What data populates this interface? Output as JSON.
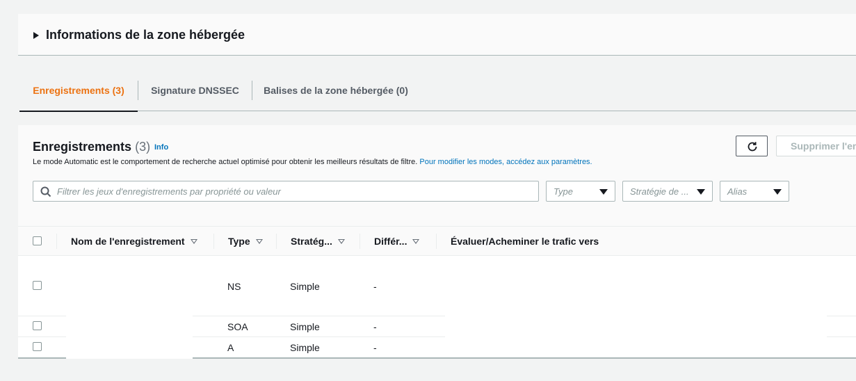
{
  "info_panel": {
    "title": "Informations de la zone hébergée"
  },
  "tabs": [
    {
      "label": "Enregistrements (3)",
      "active": true
    },
    {
      "label": "Signature DNSSEC",
      "active": false
    },
    {
      "label": "Balises de la zone hébergée (0)",
      "active": false
    }
  ],
  "records": {
    "title": "Enregistrements",
    "count": "(3)",
    "info_label": "Info",
    "description": "Le mode Automatic est le comportement de recherche actuel optimisé pour obtenir les meilleurs résultats de filtre.",
    "description_link": "Pour modifier les modes, accédez aux paramètres.",
    "delete_label": "Supprimer l'enregistrement",
    "search_placeholder": "Filtrer les jeux d'enregistrements par propriété ou valeur",
    "filters": {
      "type": "Type",
      "strategy": "Stratégie de ...",
      "alias": "Alias"
    }
  },
  "table": {
    "columns": [
      "Nom de l'enregistrement",
      "Type",
      "Stratég...",
      "Différ...",
      "Évaluer/Acheminer le trafic vers"
    ],
    "rows": [
      {
        "type": "NS",
        "strategy": "Simple",
        "diff": "-"
      },
      {
        "type": "SOA",
        "strategy": "Simple",
        "diff": "-"
      },
      {
        "type": "A",
        "strategy": "Simple",
        "diff": "-"
      }
    ]
  },
  "colors": {
    "accent": "#ec7211",
    "link": "#0073bb",
    "text": "#16191f"
  }
}
